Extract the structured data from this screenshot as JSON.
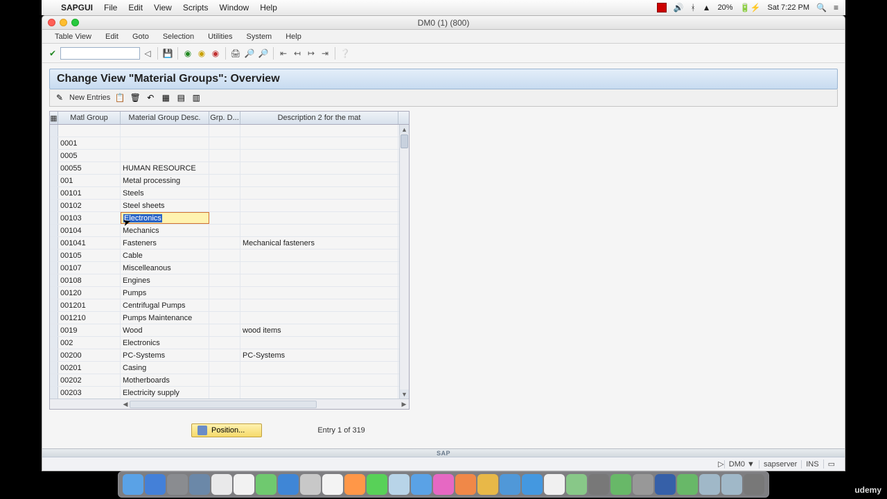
{
  "mac": {
    "appname": "SAPGUI",
    "menu": [
      "File",
      "Edit",
      "View",
      "Scripts",
      "Window",
      "Help"
    ],
    "battery": "20%",
    "time": "Sat 7:22 PM"
  },
  "window_title": "DM0 (1) (800)",
  "sap_menu": [
    "Table View",
    "Edit",
    "Goto",
    "Selection",
    "Utilities",
    "System",
    "Help"
  ],
  "screen_title": "Change View \"Material Groups\": Overview",
  "new_entries": "New Entries",
  "columns": {
    "sel": "",
    "mat": "Matl Group",
    "desc": "Material Group Desc.",
    "gd": "Grp. D...",
    "d2": "Description 2 for the mat"
  },
  "rows": [
    {
      "mat": "",
      "desc": "",
      "gd": "",
      "d2": ""
    },
    {
      "mat": "0001",
      "desc": "",
      "gd": "",
      "d2": ""
    },
    {
      "mat": "0005",
      "desc": "",
      "gd": "",
      "d2": ""
    },
    {
      "mat": "00055",
      "desc": "HUMAN RESOURCE",
      "gd": "",
      "d2": ""
    },
    {
      "mat": "001",
      "desc": "Metal processing",
      "gd": "",
      "d2": ""
    },
    {
      "mat": "00101",
      "desc": "Steels",
      "gd": "",
      "d2": ""
    },
    {
      "mat": "00102",
      "desc": "Steel sheets",
      "gd": "",
      "d2": ""
    },
    {
      "mat": "00103",
      "desc": "Electronics",
      "gd": "",
      "d2": "",
      "sel": true
    },
    {
      "mat": "00104",
      "desc": "Mechanics",
      "gd": "",
      "d2": ""
    },
    {
      "mat": "001041",
      "desc": "Fasteners",
      "gd": "",
      "d2": "Mechanical fasteners"
    },
    {
      "mat": "00105",
      "desc": "Cable",
      "gd": "",
      "d2": ""
    },
    {
      "mat": "00107",
      "desc": "Miscelleanous",
      "gd": "",
      "d2": ""
    },
    {
      "mat": "00108",
      "desc": "Engines",
      "gd": "",
      "d2": ""
    },
    {
      "mat": "00120",
      "desc": "Pumps",
      "gd": "",
      "d2": ""
    },
    {
      "mat": "001201",
      "desc": "Centrifugal Pumps",
      "gd": "",
      "d2": ""
    },
    {
      "mat": "001210",
      "desc": "Pumps Maintenance",
      "gd": "",
      "d2": ""
    },
    {
      "mat": "0019",
      "desc": "Wood",
      "gd": "",
      "d2": "wood items"
    },
    {
      "mat": "002",
      "desc": "Electronics",
      "gd": "",
      "d2": ""
    },
    {
      "mat": "00200",
      "desc": "PC-Systems",
      "gd": "",
      "d2": "PC-Systems"
    },
    {
      "mat": "00201",
      "desc": "Casing",
      "gd": "",
      "d2": ""
    },
    {
      "mat": "00202",
      "desc": "Motherboards",
      "gd": "",
      "d2": ""
    },
    {
      "mat": "00203",
      "desc": "Electricity supply",
      "gd": "",
      "d2": ""
    }
  ],
  "position_btn": "Position...",
  "entry_text": "Entry 1 of 319",
  "status": {
    "system": "DM0",
    "server": "sapserver",
    "mode": "INS"
  },
  "sap_logo": "SAP",
  "udemy": "udemy"
}
